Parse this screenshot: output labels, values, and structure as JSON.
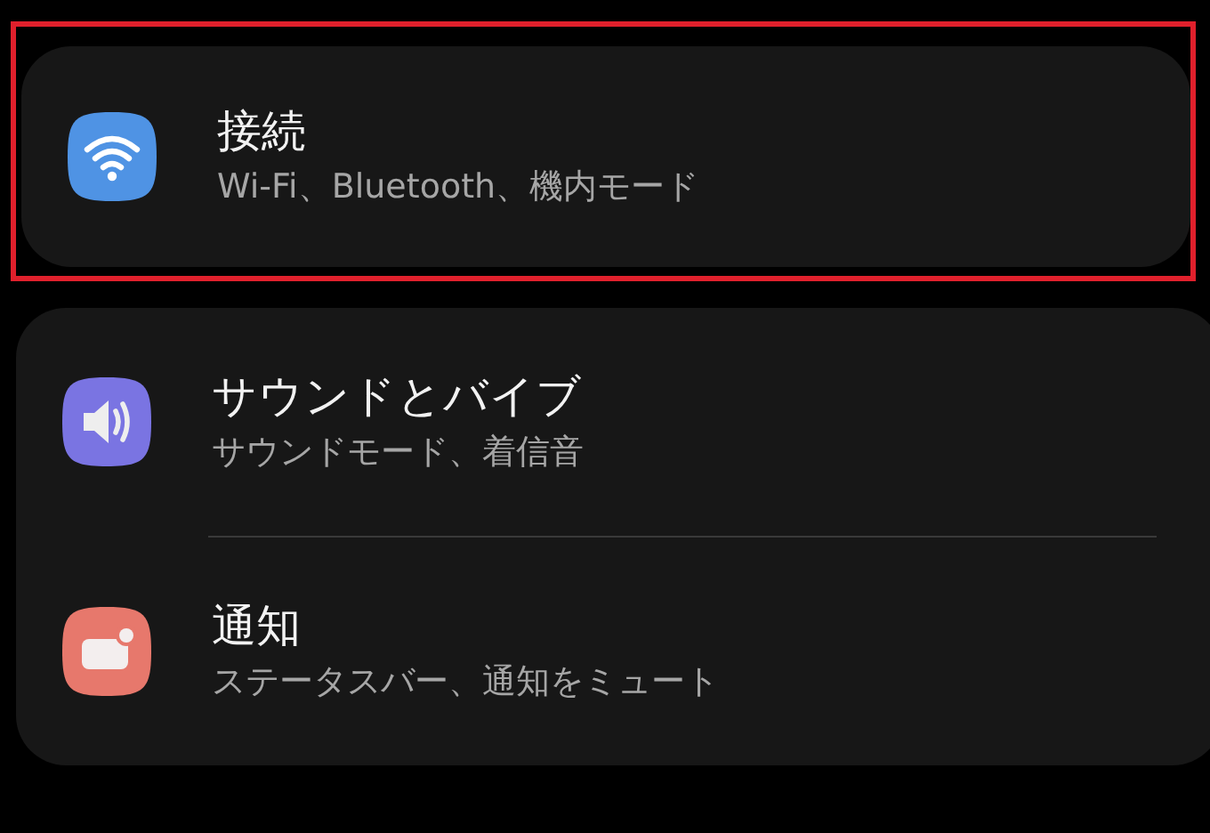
{
  "groups": [
    {
      "highlighted": true,
      "items": [
        {
          "kind": "wifi",
          "color": "#4f93e4",
          "title": "接続",
          "subtitle": "Wi-Fi、Bluetooth、機内モード"
        }
      ]
    },
    {
      "highlighted": false,
      "items": [
        {
          "kind": "sound",
          "color": "#7a74e2",
          "title": "サウンドとバイブ",
          "subtitle": "サウンドモード、着信音"
        },
        {
          "kind": "notification",
          "color": "#e7786c",
          "title": "通知",
          "subtitle": "ステータスバー、通知をミュート"
        }
      ]
    }
  ]
}
